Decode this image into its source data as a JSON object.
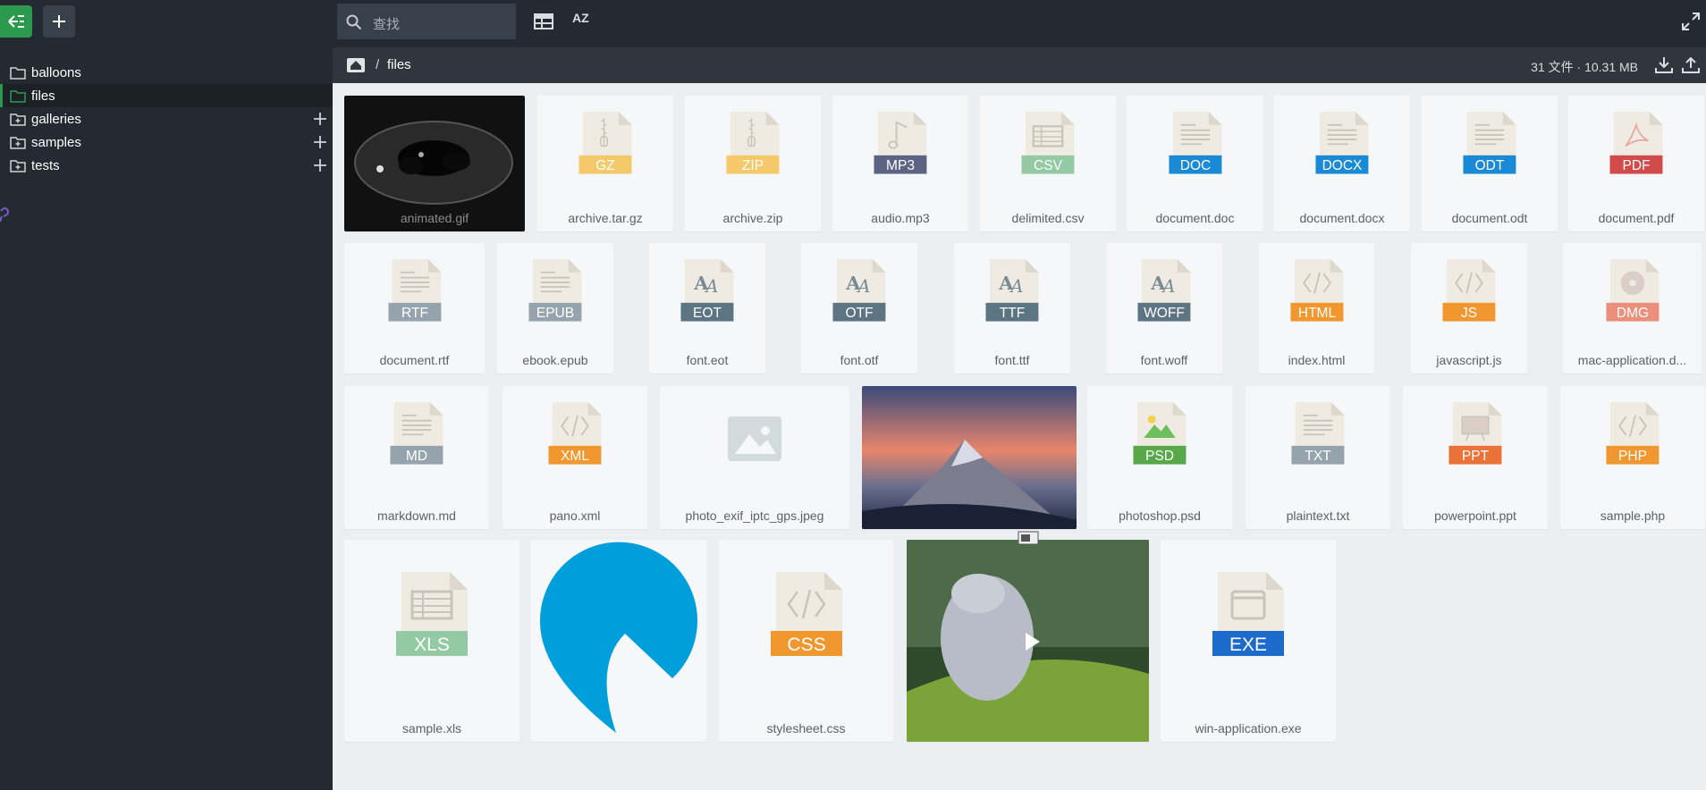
{
  "search": {
    "placeholder": "查找"
  },
  "toolbar": {
    "sort_label": "AZ"
  },
  "sidebar": {
    "items": [
      {
        "label": "balloons",
        "expandable": false,
        "active": false
      },
      {
        "label": "files",
        "expandable": false,
        "active": true
      },
      {
        "label": "galleries",
        "expandable": true,
        "active": false
      },
      {
        "label": "samples",
        "expandable": true,
        "active": false
      },
      {
        "label": "tests",
        "expandable": true,
        "active": false
      }
    ]
  },
  "path": {
    "separator": "/",
    "current": "files"
  },
  "stats": {
    "text": "31 文件 · 10.31 MB"
  },
  "files": [
    {
      "name": "animated.gif",
      "kind": "image",
      "preview": "gif"
    },
    {
      "name": "archive.tar.gz",
      "kind": "file",
      "icon": "zip-icon",
      "badge": "GZ",
      "color": "#f5c96a"
    },
    {
      "name": "archive.zip",
      "kind": "file",
      "icon": "zip-icon",
      "badge": "ZIP",
      "color": "#f5c96a"
    },
    {
      "name": "audio.mp3",
      "kind": "file",
      "icon": "music-icon",
      "badge": "MP3",
      "color": "#5c6483"
    },
    {
      "name": "delimited.csv",
      "kind": "file",
      "icon": "table-icon",
      "badge": "CSV",
      "color": "#93c9a3"
    },
    {
      "name": "document.doc",
      "kind": "file",
      "icon": "text-lines-icon",
      "badge": "DOC",
      "color": "#1a8ad6"
    },
    {
      "name": "document.docx",
      "kind": "file",
      "icon": "text-lines-icon",
      "badge": "DOCX",
      "color": "#1a8ad6"
    },
    {
      "name": "document.odt",
      "kind": "file",
      "icon": "text-lines-icon",
      "badge": "ODT",
      "color": "#1a8ad6"
    },
    {
      "name": "document.pdf",
      "kind": "file",
      "icon": "pdf-icon",
      "badge": "PDF",
      "color": "#d24b4b"
    },
    {
      "name": "document.rtf",
      "kind": "file",
      "icon": "text-lines-icon",
      "badge": "RTF",
      "color": "#95a3ad"
    },
    {
      "name": "ebook.epub",
      "kind": "file",
      "icon": "text-lines-icon",
      "badge": "EPUB",
      "color": "#95a3ad"
    },
    {
      "name": "font.eot",
      "kind": "file",
      "icon": "font-icon",
      "badge": "EOT",
      "color": "#5d7583"
    },
    {
      "name": "font.otf",
      "kind": "file",
      "icon": "font-icon",
      "badge": "OTF",
      "color": "#5d7583"
    },
    {
      "name": "font.ttf",
      "kind": "file",
      "icon": "font-icon",
      "badge": "TTF",
      "color": "#5d7583"
    },
    {
      "name": "font.woff",
      "kind": "file",
      "icon": "font-icon",
      "badge": "WOFF",
      "color": "#5d7583"
    },
    {
      "name": "index.html",
      "kind": "file",
      "icon": "code-icon",
      "badge": "HTML",
      "color": "#f0972f"
    },
    {
      "name": "javascript.js",
      "kind": "file",
      "icon": "code-icon",
      "badge": "JS",
      "color": "#f0972f"
    },
    {
      "name": "mac-application.d...",
      "kind": "file",
      "icon": "disc-icon",
      "badge": "DMG",
      "color": "#ec8e7c"
    },
    {
      "name": "markdown.md",
      "kind": "file",
      "icon": "text-lines-icon",
      "badge": "MD",
      "color": "#95a3ad"
    },
    {
      "name": "pano.xml",
      "kind": "file",
      "icon": "code-icon",
      "badge": "XML",
      "color": "#f0972f"
    },
    {
      "name": "photo_exif_iptc_gps.jpeg",
      "kind": "placeholder",
      "icon": "image-placeholder-icon"
    },
    {
      "name": "",
      "kind": "image",
      "preview": "mountain"
    },
    {
      "name": "photoshop.psd",
      "kind": "file",
      "icon": "picture-icon",
      "badge": "PSD",
      "color": "#58a84a"
    },
    {
      "name": "plaintext.txt",
      "kind": "file",
      "icon": "text-lines-icon",
      "badge": "TXT",
      "color": "#95a3ad"
    },
    {
      "name": "powerpoint.ppt",
      "kind": "file",
      "icon": "presentation-icon",
      "badge": "PPT",
      "color": "#ea7238"
    },
    {
      "name": "sample.php",
      "kind": "file",
      "icon": "code-icon",
      "badge": "PHP",
      "color": "#f0972f"
    },
    {
      "name": "sample.xls",
      "kind": "file",
      "icon": "table-icon",
      "badge": "XLS",
      "color": "#93c9a3"
    },
    {
      "name": "",
      "kind": "image",
      "preview": "logo"
    },
    {
      "name": "stylesheet.css",
      "kind": "file",
      "icon": "code-icon",
      "badge": "CSS",
      "color": "#f0972f"
    },
    {
      "name": "",
      "kind": "video",
      "preview": "video"
    },
    {
      "name": "win-application.exe",
      "kind": "file",
      "icon": "window-icon",
      "badge": "EXE",
      "color": "#1c6ac9"
    }
  ]
}
